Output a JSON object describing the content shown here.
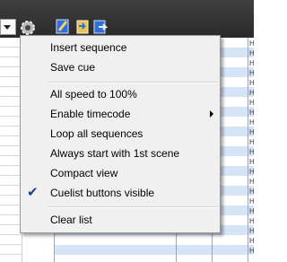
{
  "toolbar": {
    "icons": [
      "dropdown-arrow-icon",
      "gear-icon",
      "edit-cue-icon",
      "import-icon",
      "export-icon"
    ]
  },
  "grid": {
    "cell_text": "H"
  },
  "menu": {
    "items": [
      {
        "label": "Insert sequence"
      },
      {
        "label": "Save cue"
      },
      {
        "label": "All speed to 100%"
      },
      {
        "label": "Enable timecode",
        "submenu": true
      },
      {
        "label": "Loop all sequences"
      },
      {
        "label": "Always start with 1st scene"
      },
      {
        "label": "Compact view"
      },
      {
        "label": "Cuelist buttons visible",
        "checked": true
      },
      {
        "label": "Clear list"
      }
    ]
  },
  "colors": {
    "toolbar": "#2f2f2f",
    "menu_bg": "#f0f0f0",
    "row_alt": "#d6e4f7",
    "check": "#1c3f94"
  }
}
